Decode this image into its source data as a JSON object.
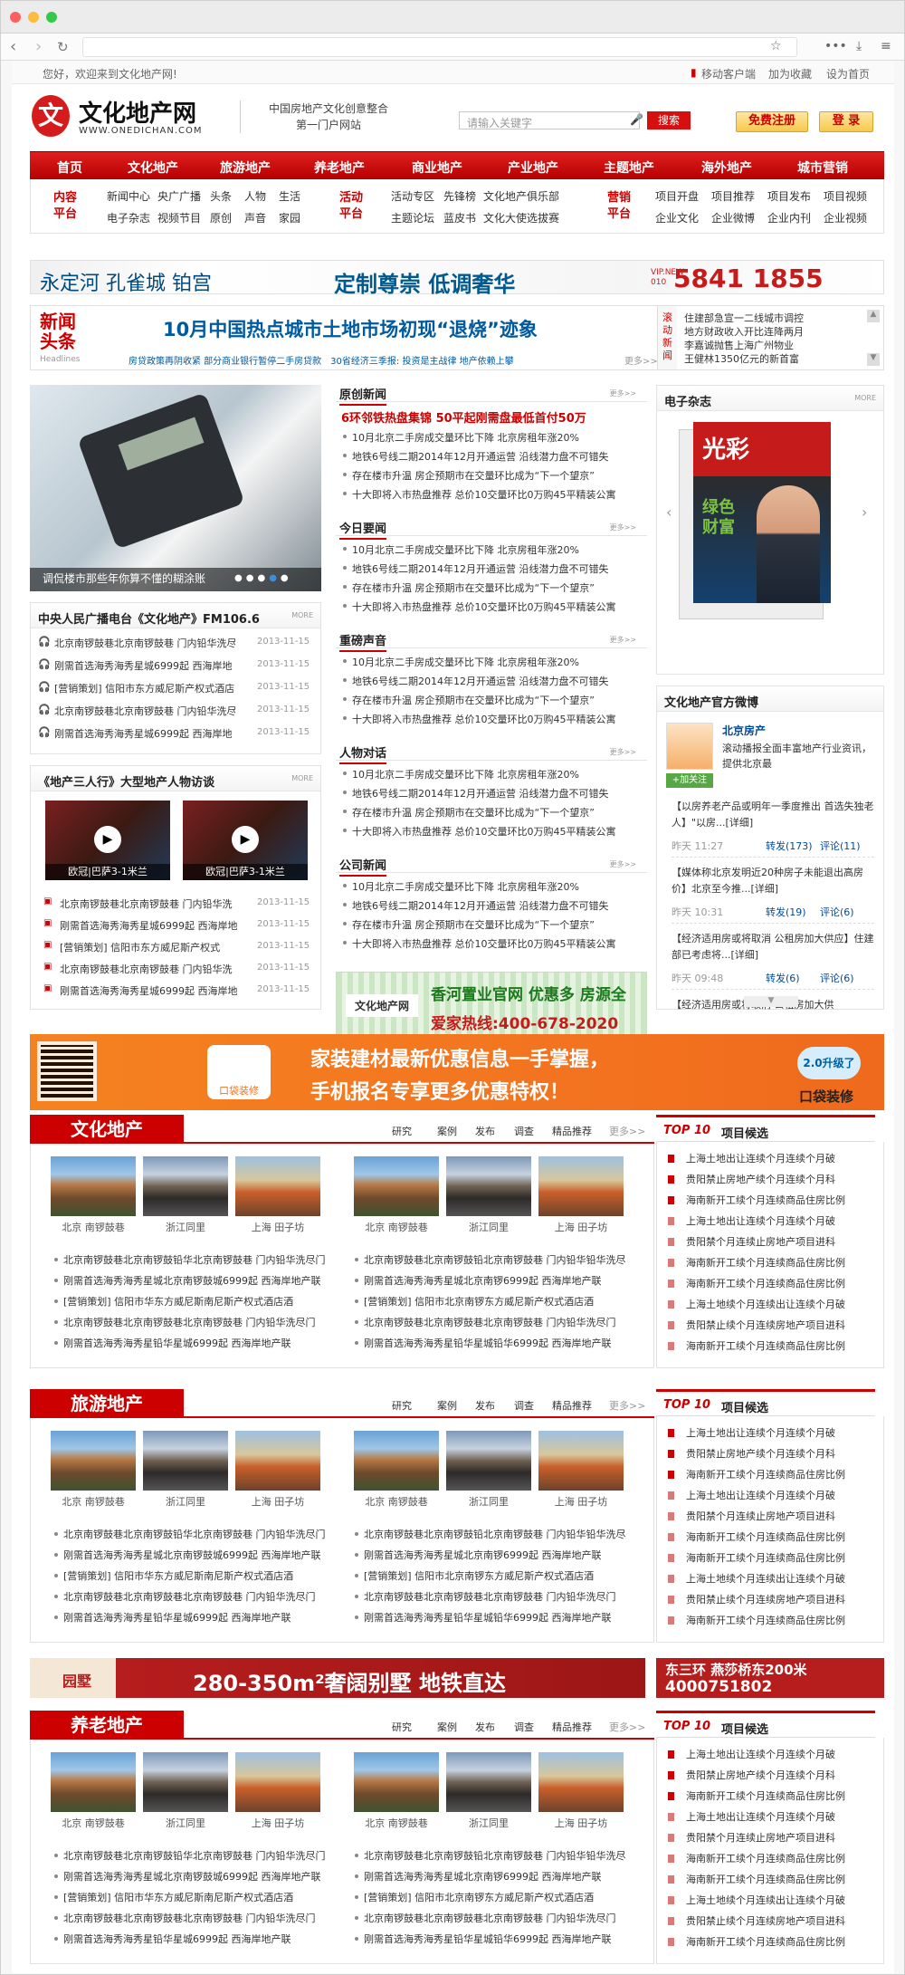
{
  "browser": {
    "tab": "",
    "url": ""
  },
  "topbar": {
    "welcome": "您好，欢迎来到文化地产网!",
    "mobile": "移动客户端",
    "fav": "加为收藏",
    "home": "设为首页"
  },
  "header": {
    "logo_title": "文化地产网",
    "logo_url": "WWW.ONEDICHAN.COM",
    "logo_glyph": "文",
    "slogan1": "中国房地产文化创意整合",
    "slogan2": "第一门户网站",
    "search_placeholder": "请输入关键字",
    "search_btn": "搜索",
    "register": "免费注册",
    "login": "登 录"
  },
  "nav": [
    "首页",
    "文化地产",
    "旅游地产",
    "养老地产",
    "商业地产",
    "产业地产",
    "主题地产",
    "海外地产",
    "城市营销"
  ],
  "subnav": {
    "g1": {
      "label": "内容\n平台",
      "links": [
        "新闻中心",
        "央广广播",
        "头条",
        "人物",
        "生活",
        "电子杂志",
        "视频节目",
        "原创",
        "声音",
        "家园"
      ]
    },
    "g2": {
      "label": "活动\n平台",
      "links": [
        "活动专区",
        "先锋榜",
        "文化地产俱乐部",
        "主题论坛",
        "蓝皮书",
        "文化大使选拔赛"
      ]
    },
    "g3": {
      "label": "营销\n平台",
      "links": [
        "项目开盘",
        "项目推荐",
        "项目发布",
        "项目视频",
        "企业文化",
        "企业微博",
        "企业内刊",
        "企业视频"
      ]
    }
  },
  "banner1": {
    "brand": "永定河 孔雀城 铂宫",
    "slogan": "定制尊崇  低调奢华",
    "vip": "VIP.NEW 010",
    "phone": "5841 1855"
  },
  "headline": {
    "label1": "新闻",
    "label2": "头条",
    "label3": "Headlines",
    "title": "10月中国热点城市土地市场初现“退烧”迹象",
    "sub": "房贷政策再阴收紧 部分商业银行暂停二手房贷款　30省经济三季报: 投资是主战律 地产依赖上攀",
    "more": "更多>>",
    "scroll_label": "滚动新闻",
    "scroll": [
      "住建部急宣一二线城市调控",
      "地方财政收入开比连降两月",
      "李嘉诚抛售上海广州物业",
      "王健林1350亿元的新首富"
    ]
  },
  "slider": {
    "caption": "调侃楼市那些年你算不懂的糊涂账"
  },
  "radio": {
    "title": "中央人民广播电台《文化地产》FM106.6",
    "more": "MORE",
    "items": [
      {
        "t": "北京南锣鼓巷北京南锣鼓巷 门内铅华洗尽",
        "d": "2013-11-15"
      },
      {
        "t": "刚需首选海秀海秀星城6999起 西海岸地",
        "d": "2013-11-15"
      },
      {
        "t": "[营销策划] 信阳市东方威尼斯产权式酒店",
        "d": "2013-11-15"
      },
      {
        "t": "北京南锣鼓巷北京南锣鼓巷 门内铅华洗尽",
        "d": "2013-11-15"
      },
      {
        "t": "刚需首选海秀海秀星城6999起 西海岸地",
        "d": "2013-11-15"
      }
    ]
  },
  "interview": {
    "title": "《地产三人行》大型地产人物访谈",
    "more": "MORE",
    "videos": [
      "欧冠|巴萨3-1米兰",
      "欧冠|巴萨3-1米兰"
    ],
    "items": [
      {
        "t": "北京南锣鼓巷北京南锣鼓巷 门内铅华洗",
        "d": "2013-11-15"
      },
      {
        "t": "刚需首选海秀海秀星城6999起 西海岸地",
        "d": "2013-11-15"
      },
      {
        "t": "[营销策划] 信阳市东方威尼斯产权式",
        "d": "2013-11-15"
      },
      {
        "t": "北京南锣鼓巷北京南锣鼓巷 门内铅华洗",
        "d": "2013-11-15"
      },
      {
        "t": "刚需首选海秀海秀星城6999起 西海岸地",
        "d": "2013-11-15"
      }
    ]
  },
  "midcol": {
    "headline": "6环邻铁热盘集锦 50平起刚需盘最低首付50万",
    "sections": [
      {
        "title": "原创新闻",
        "items": [
          "10月北京二手房成交量环比下降 北京房租年涨20%",
          "地铁6号线二期2014年12月开通运营 沿线潜力盘不可错失",
          "存在楼市升温 房企预期市在交量环比成为“下一个望京”",
          "十大即将入市热盘推荐 总价10交量环比0万购45平精装公寓"
        ]
      },
      {
        "title": "今日要闻",
        "items": [
          "10月北京二手房成交量环比下降 北京房租年涨20%",
          "地铁6号线二期2014年12月开通运营 沿线潜力盘不可错失",
          "存在楼市升温 房企预期市在交量环比成为“下一个望京”",
          "十大即将入市热盘推荐 总价10交量环比0万购45平精装公寓"
        ]
      },
      {
        "title": "重磅声音",
        "items": [
          "10月北京二手房成交量环比下降 北京房租年涨20%",
          "地铁6号线二期2014年12月开通运营 沿线潜力盘不可错失",
          "存在楼市升温 房企预期市在交量环比成为“下一个望京”",
          "十大即将入市热盘推荐 总价10交量环比0万购45平精装公寓"
        ]
      },
      {
        "title": "人物对话",
        "items": [
          "10月北京二手房成交量环比下降 北京房租年涨20%",
          "地铁6号线二期2014年12月开通运营 沿线潜力盘不可错失",
          "存在楼市升温 房企预期市在交量环比成为“下一个望京”",
          "十大即将入市热盘推荐 总价10交量环比0万购45平精装公寓"
        ]
      },
      {
        "title": "公司新闻",
        "items": [
          "10月北京二手房成交量环比下降 北京房租年涨20%",
          "地铁6号线二期2014年12月开通运营 沿线潜力盘不可错失",
          "存在楼市升温 房企预期市在交量环比成为“下一个望京”",
          "十大即将入市热盘推荐 总价10交量环比0万购45平精装公寓"
        ]
      }
    ],
    "more": "更多>>",
    "ad": {
      "logo": "文化地产网",
      "title": "香河置业官网 优惠多 房源全",
      "hotline": "爱家热线:400-678-2020"
    }
  },
  "magazine": {
    "title": "电子杂志",
    "more": "MORE",
    "cover_title": "光彩",
    "cover_sub1": "绿色",
    "cover_sub2": "财富"
  },
  "weibo": {
    "title": "文化地产官方微博",
    "name": "北京房产",
    "desc": "滚动播报全面丰富地产行业资讯，提供北京最",
    "follow": "+加关注",
    "posts": [
      {
        "t": "【以房养老产品或明年一季度推出 首选失独老人】\"以房...[详细]",
        "time": "昨天 11:27",
        "rt": "转发(173)",
        "cm": "评论(11)"
      },
      {
        "t": "【媒体称北京发明近20种房子未能退出高房价】北京至今推...[详细]",
        "time": "昨天 10:31",
        "rt": "转发(19)",
        "cm": "评论(6)"
      },
      {
        "t": "【经济适用房或将取消 公租房加大供应】住建部已考虑将...[详细]",
        "time": "昨天 09:48",
        "rt": "转发(6)",
        "cm": "评论(6)"
      },
      {
        "t": "【经济适用房或将取消 公租房加大供",
        "time": "",
        "rt": "",
        "cm": ""
      }
    ]
  },
  "orange": {
    "line1": "家装建材最新优惠信息一手掌握，",
    "line2": "手机报名专享更多优惠特权！",
    "app": "口袋装修",
    "badge": "2.0升级了",
    "app2": "口袋装修"
  },
  "sections": [
    {
      "title": "文化地产",
      "tabs": [
        "研究",
        "案例",
        "发布",
        "调查",
        "精品推荐",
        "更多>>"
      ],
      "caps": [
        "北京 南锣鼓巷",
        "浙江同里",
        "上海 田子坊",
        "北京 南锣鼓巷",
        "浙江同里",
        "上海 田子坊"
      ],
      "left": [
        "北京南锣鼓巷北京南锣鼓铅华北京南锣鼓巷 门内铅华洗尽门",
        "刚需首选海秀海秀星城北京南锣鼓城6999起 西海岸地产联",
        "[营销策划] 信阳市华东方威尼斯南尼斯产权式酒店酒",
        "北京南锣鼓巷北京南锣鼓巷北京南锣鼓巷 门内铅华洗尽门",
        "刚需首选海秀海秀星铅华星城6999起 西海岸地产联"
      ],
      "right": [
        "北京南锣鼓巷北京南锣鼓铅北京南锣鼓巷 门内铅华铅华洗尽",
        "刚需首选海秀海秀星城北京南锣6999起 西海岸地产联",
        "[营销策划] 信阳市北京南锣东方威尼斯产权式酒店酒",
        "北京南锣鼓巷北京南锣鼓巷北京南锣鼓巷 门内铅华洗尽门",
        "刚需首选海秀海秀星铅华星城铅华6999起 西海岸地产联"
      ],
      "top10": [
        "上海土地出让连续个月连续个月破",
        "贵阳禁止房地产续个月连续个月科",
        "海南新开工续个月连续商品住房比例",
        "上海土地出让连续个月连续个月破",
        "贵阳禁个月连续止房地产项目进科",
        "海南新开工续个月连续商品住房比例",
        "海南新开工续个月连续商品住房比例",
        "上海土地续个月连续出让连续个月破",
        "贵阳禁止续个月连续房地产项目进科",
        "海南新开工续个月连续商品住房比例"
      ]
    },
    {
      "title": "旅游地产",
      "tabs": [
        "研究",
        "案例",
        "发布",
        "调查",
        "精品推荐",
        "更多>>"
      ],
      "caps": [
        "北京 南锣鼓巷",
        "浙江同里",
        "上海 田子坊",
        "北京 南锣鼓巷",
        "浙江同里",
        "上海 田子坊"
      ],
      "left": [
        "北京南锣鼓巷北京南锣鼓铅华北京南锣鼓巷 门内铅华洗尽门",
        "刚需首选海秀海秀星城北京南锣鼓城6999起 西海岸地产联",
        "[营销策划] 信阳市华东方威尼斯南尼斯产权式酒店酒",
        "北京南锣鼓巷北京南锣鼓巷北京南锣鼓巷 门内铅华洗尽门",
        "刚需首选海秀海秀星铅华星城6999起 西海岸地产联"
      ],
      "right": [
        "北京南锣鼓巷北京南锣鼓铅北京南锣鼓巷 门内铅华铅华洗尽",
        "刚需首选海秀海秀星城北京南锣6999起 西海岸地产联",
        "[营销策划] 信阳市北京南锣东方威尼斯产权式酒店酒",
        "北京南锣鼓巷北京南锣鼓巷北京南锣鼓巷 门内铅华洗尽门",
        "刚需首选海秀海秀星铅华星城铅华6999起 西海岸地产联"
      ],
      "top10": [
        "上海土地出让连续个月连续个月破",
        "贵阳禁止房地产续个月连续个月科",
        "海南新开工续个月连续商品住房比例",
        "上海土地出让连续个月连续个月破",
        "贵阳禁个月连续止房地产项目进科",
        "海南新开工续个月连续商品住房比例",
        "海南新开工续个月连续商品住房比例",
        "上海土地续个月连续出让连续个月破",
        "贵阳禁止续个月连续房地产项目进科",
        "海南新开工续个月连续商品住房比例"
      ]
    },
    {
      "title": "养老地产",
      "tabs": [
        "研究",
        "案例",
        "发布",
        "调查",
        "精品推荐",
        "更多>>"
      ],
      "caps": [
        "北京 南锣鼓巷",
        "浙江同里",
        "上海 田子坊",
        "北京 南锣鼓巷",
        "浙江同里",
        "上海 田子坊"
      ],
      "left": [
        "北京南锣鼓巷北京南锣鼓铅华北京南锣鼓巷 门内铅华洗尽门",
        "刚需首选海秀海秀星城北京南锣鼓城6999起 西海岸地产联",
        "[营销策划] 信阳市华东方威尼斯南尼斯产权式酒店酒",
        "北京南锣鼓巷北京南锣鼓巷北京南锣鼓巷 门内铅华洗尽门",
        "刚需首选海秀海秀星铅华星城6999起 西海岸地产联"
      ],
      "right": [
        "北京南锣鼓巷北京南锣鼓铅北京南锣鼓巷 门内铅华铅华洗尽",
        "刚需首选海秀海秀星城北京南锣6999起 西海岸地产联",
        "[营销策划] 信阳市北京南锣东方威尼斯产权式酒店酒",
        "北京南锣鼓巷北京南锣鼓巷北京南锣鼓巷 门内铅华洗尽门",
        "刚需首选海秀海秀星铅华星城铅华6999起 西海岸地产联"
      ],
      "top10": [
        "上海土地出让连续个月连续个月破",
        "贵阳禁止房地产续个月连续个月科",
        "海南新开工续个月连续商品住房比例",
        "上海土地出让连续个月连续个月破",
        "贵阳禁个月连续止房地产项目进科",
        "海南新开工续个月连续商品住房比例",
        "海南新开工续个月连续商品住房比例",
        "上海土地续个月连续出让连续个月破",
        "贵阳禁止续个月连续房地产项目进科",
        "海南新开工续个月连续商品住房比例"
      ]
    }
  ],
  "top10_label": "TOP 10",
  "top10_title": "项目候选",
  "villa": {
    "brand": "园墅",
    "title": "280-350m²奢阔别墅 地铁直达",
    "side1": "东三环  燕莎桥东200米",
    "side2": "4000751802"
  }
}
